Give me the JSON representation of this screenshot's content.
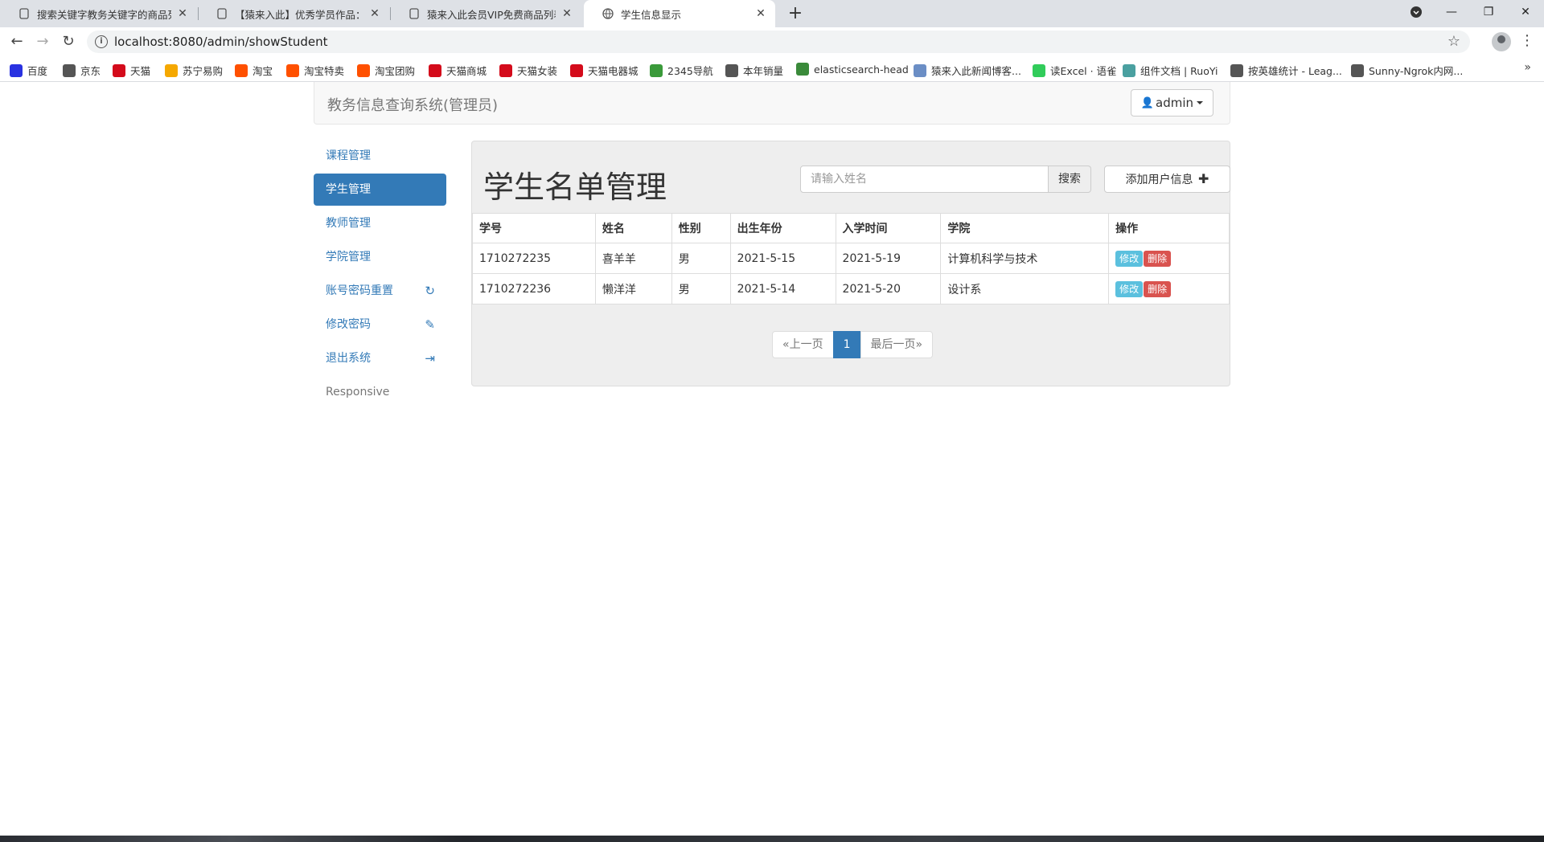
{
  "browser": {
    "tabs": [
      {
        "title": "搜索关键字教务关键字的商品列表",
        "icon": "page-icon"
      },
      {
        "title": "【猿来入此】优秀学员作品：Spr",
        "icon": "page-icon"
      },
      {
        "title": "猿来入此会员VIP免费商品列表|",
        "icon": "page-icon"
      },
      {
        "title": "学生信息显示",
        "icon": "globe-icon"
      }
    ],
    "url": "localhost:8080/admin/showStudent",
    "bookmarks": [
      {
        "label": "百度",
        "icon_color": "#2932e1"
      },
      {
        "label": "京东",
        "icon_color": "#555555"
      },
      {
        "label": "天猫",
        "icon_color": "#d40b1b"
      },
      {
        "label": "苏宁易购",
        "icon_color": "#f5a800"
      },
      {
        "label": "淘宝",
        "icon_color": "#ff5000"
      },
      {
        "label": "淘宝特卖",
        "icon_color": "#ff5000"
      },
      {
        "label": "淘宝团购",
        "icon_color": "#ff5000"
      },
      {
        "label": "天猫商城",
        "icon_color": "#d40b1b"
      },
      {
        "label": "天猫女装",
        "icon_color": "#d40b1b"
      },
      {
        "label": "天猫电器城",
        "icon_color": "#d40b1b"
      },
      {
        "label": "2345导航",
        "icon_color": "#3a9a3a"
      },
      {
        "label": "本年销量",
        "icon_color": "#555555"
      },
      {
        "label": "elasticsearch-head",
        "icon_color": "#3a8a3a"
      },
      {
        "label": "猿来入此新闻博客...",
        "icon_color": "#6b8ec5"
      },
      {
        "label": "读Excel · 语雀",
        "icon_color": "#31cc5a"
      },
      {
        "label": "组件文档 | RuoYi",
        "icon_color": "#4aa0a0"
      },
      {
        "label": "按英雄统计 - Leag...",
        "icon_color": "#555555"
      },
      {
        "label": "Sunny-Ngrok内网...",
        "icon_color": "#555555"
      }
    ],
    "more": "»"
  },
  "app": {
    "brand": "教务信息查询系统(管理员)",
    "user": "admin",
    "accent": "#337ab7"
  },
  "sidebar": {
    "items": [
      {
        "label": "课程管理",
        "active": false,
        "icon": ""
      },
      {
        "label": "学生管理",
        "active": true,
        "icon": ""
      },
      {
        "label": "教师管理",
        "active": false,
        "icon": ""
      },
      {
        "label": "学院管理",
        "active": false,
        "icon": ""
      },
      {
        "label": "账号密码重置",
        "active": false,
        "icon": "refresh-icon"
      },
      {
        "label": "修改密码",
        "active": false,
        "icon": "pencil-icon"
      },
      {
        "label": "退出系统",
        "active": false,
        "icon": "logout-icon"
      },
      {
        "label": "Responsive",
        "active": false,
        "icon": ""
      }
    ]
  },
  "main": {
    "title": "学生名单管理",
    "search_placeholder": "请输入姓名",
    "search_label": "搜索",
    "add_label": "添加用户信息"
  },
  "table": {
    "headers": [
      "学号",
      "姓名",
      "性别",
      "出生年份",
      "入学时间",
      "学院",
      "操作"
    ],
    "rows": [
      {
        "id": "1710272235",
        "name": "喜羊羊",
        "sex": "男",
        "birth": "2021-5-15",
        "enroll": "2021-5-19",
        "college": "计算机科学与技术"
      },
      {
        "id": "1710272236",
        "name": "懒洋洋",
        "sex": "男",
        "birth": "2021-5-14",
        "enroll": "2021-5-20",
        "college": "设计系"
      }
    ],
    "edit_label": "修改",
    "delete_label": "删除"
  },
  "pagination": {
    "prev": "«上一页",
    "current": "1",
    "last": "最后一页»"
  }
}
